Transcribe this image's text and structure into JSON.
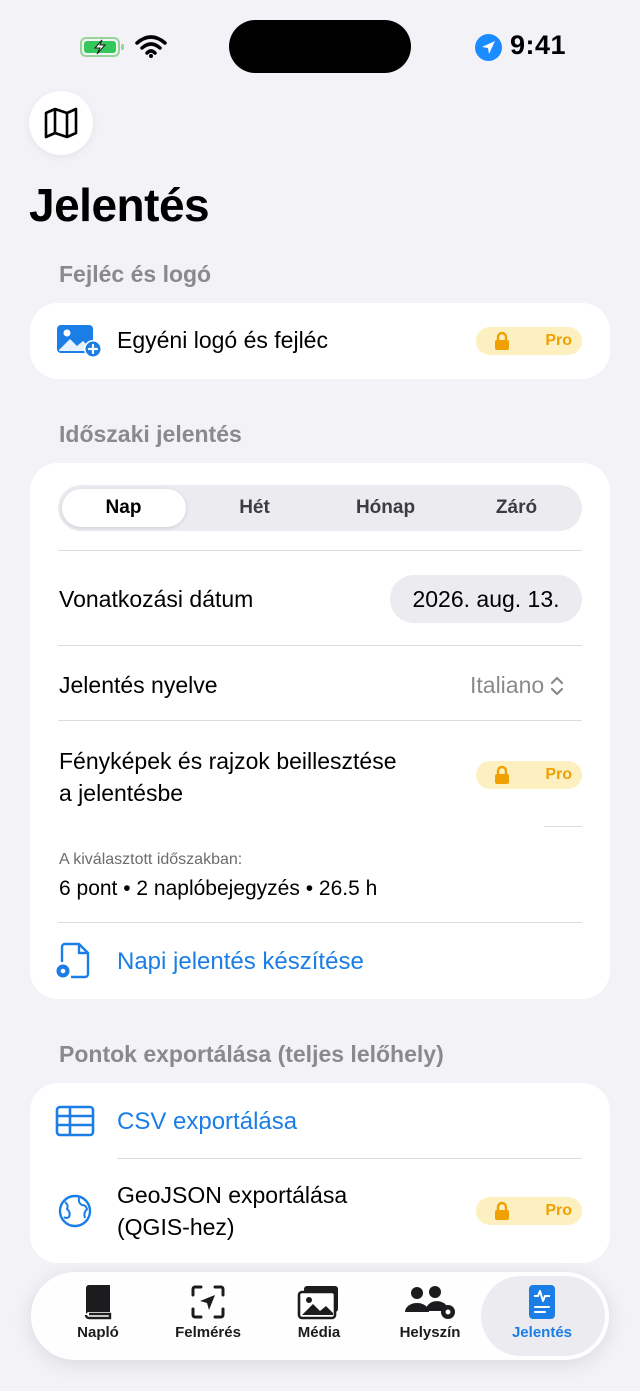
{
  "status": {
    "time": "9:41"
  },
  "page": {
    "title": "Jelentés"
  },
  "header_section": {
    "title": "Fejléc és logó",
    "custom_logo_label": "Egyéni logó és fejléc",
    "pro_label": "Pro"
  },
  "periodic_section": {
    "title": "Időszaki jelentés",
    "segments": [
      "Nap",
      "Hét",
      "Hónap",
      "Záró"
    ],
    "selected_segment": "Nap",
    "reference_date_label": "Vonatkozási dátum",
    "reference_date_value": "2026. aug. 13.",
    "language_label": "Jelentés nyelve",
    "language_value": "Italiano",
    "photos_label_line1": "Fényképek és rajzok beillesztése",
    "photos_label_line2": "a jelentésbe",
    "pro_label": "Pro",
    "summary_caption": "A kiválasztott időszakban:",
    "summary_value": "6 pont • 2 naplóbejegyzés • 26.5 h",
    "create_report_label": "Napi jelentés készítése"
  },
  "export_section": {
    "title": "Pontok exportálása (teljes lelőhely)",
    "csv_label": "CSV exportálása",
    "geojson_label_line1": "GeoJSON exportálása",
    "geojson_label_line2": "(QGIS-hez)",
    "pro_label": "Pro"
  },
  "tabbar": {
    "tabs": [
      {
        "label": "Napló",
        "icon": "book-icon"
      },
      {
        "label": "Felmérés",
        "icon": "navigation-icon"
      },
      {
        "label": "Média",
        "icon": "photos-icon"
      },
      {
        "label": "Helyszín",
        "icon": "people-gear-icon"
      },
      {
        "label": "Jelentés",
        "icon": "report-icon"
      }
    ],
    "active": "Jelentés"
  },
  "colors": {
    "accent": "#1a7ee6",
    "pro_bg": "#fdf0c0",
    "pro_fg": "#f0a000",
    "background": "#f2f2f7"
  }
}
